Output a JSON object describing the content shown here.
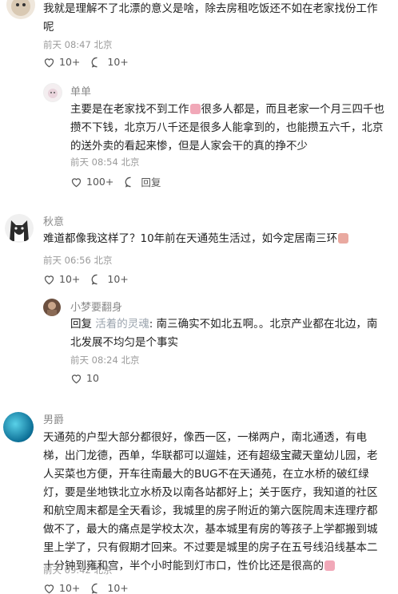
{
  "comments": [
    {
      "text": "我就是理解不了北漂的意义是啥，除去房租吃饭还不如在老家找份工作呢",
      "lines": [
        "我就是理解不了北漂的意义是啥，除去房租吃饭还不如在老家找份工作",
        "呢"
      ],
      "time": "前天 08:47 北京",
      "likes": "10+",
      "replies": "10+",
      "reply": {
        "user": "单单",
        "lines": [
          "主要是在老家找不到工作",
          "很多人都是，而且老家一个月三四千也",
          "攒不下钱，北京万八千还是很多人能拿到的，也能攒五六千，北京",
          "的送外卖的看起来惨，但是人家会干的真的挣不少"
        ],
        "time": "前天 08:54 北京",
        "likes": "100+",
        "reply_label": "回复"
      }
    },
    {
      "user": "秋意",
      "lines": [
        "难道都像我这样了？10年前在天通苑生活过，如今定居南三环"
      ],
      "time": "前天 06:56 北京",
      "likes": "10+",
      "replies": "10+",
      "reply": {
        "user": "小梦要翻身",
        "prefix": "回复 ",
        "mention": "活着的灵魂",
        "lines_first": ": 南三确实不如北五啊。。北京产业都在北边，南",
        "lines_rest": [
          "北发展不均匀是个事实"
        ],
        "time": "前天 08:24 北京",
        "likes": "10"
      }
    },
    {
      "user": "男爵",
      "lines": [
        "天通苑的户型大部分都很好，像西一区，一梯两户，南北通透，有电",
        "梯，出门龙德，西单，华联都可以遛娃，还有超级宝藏天童幼儿园，老",
        "人买菜也方便，开车往南最大的BUG不在天通苑，在立水桥的破红绿",
        "灯，要是坐地铁北立水桥及以南各站都好上；关于医疗，我知道的社区",
        "和航空周末都是全天看诊，我城里的房子附近的第六医院周末连理疗都",
        "做不了，最大的痛点是学校太次，基本城里有房的等孩子上学都搬到城",
        "里上学了，只有假期才回来。不过要是城里的房子在五号线沿线基本二",
        "十分钟到雍和宫，半个小时能到灯市口，性价比还是很高的"
      ],
      "time": "前天 09:42 北京",
      "likes": "10+",
      "replies": "10+"
    }
  ],
  "colors": {
    "text": "#222222",
    "meta": "#9a9a9a",
    "name": "#8a8a8a",
    "link": "#9aa3ad"
  },
  "icons": [
    "heart-icon",
    "comment-bubble-icon",
    "emoji-sticker-icon"
  ]
}
